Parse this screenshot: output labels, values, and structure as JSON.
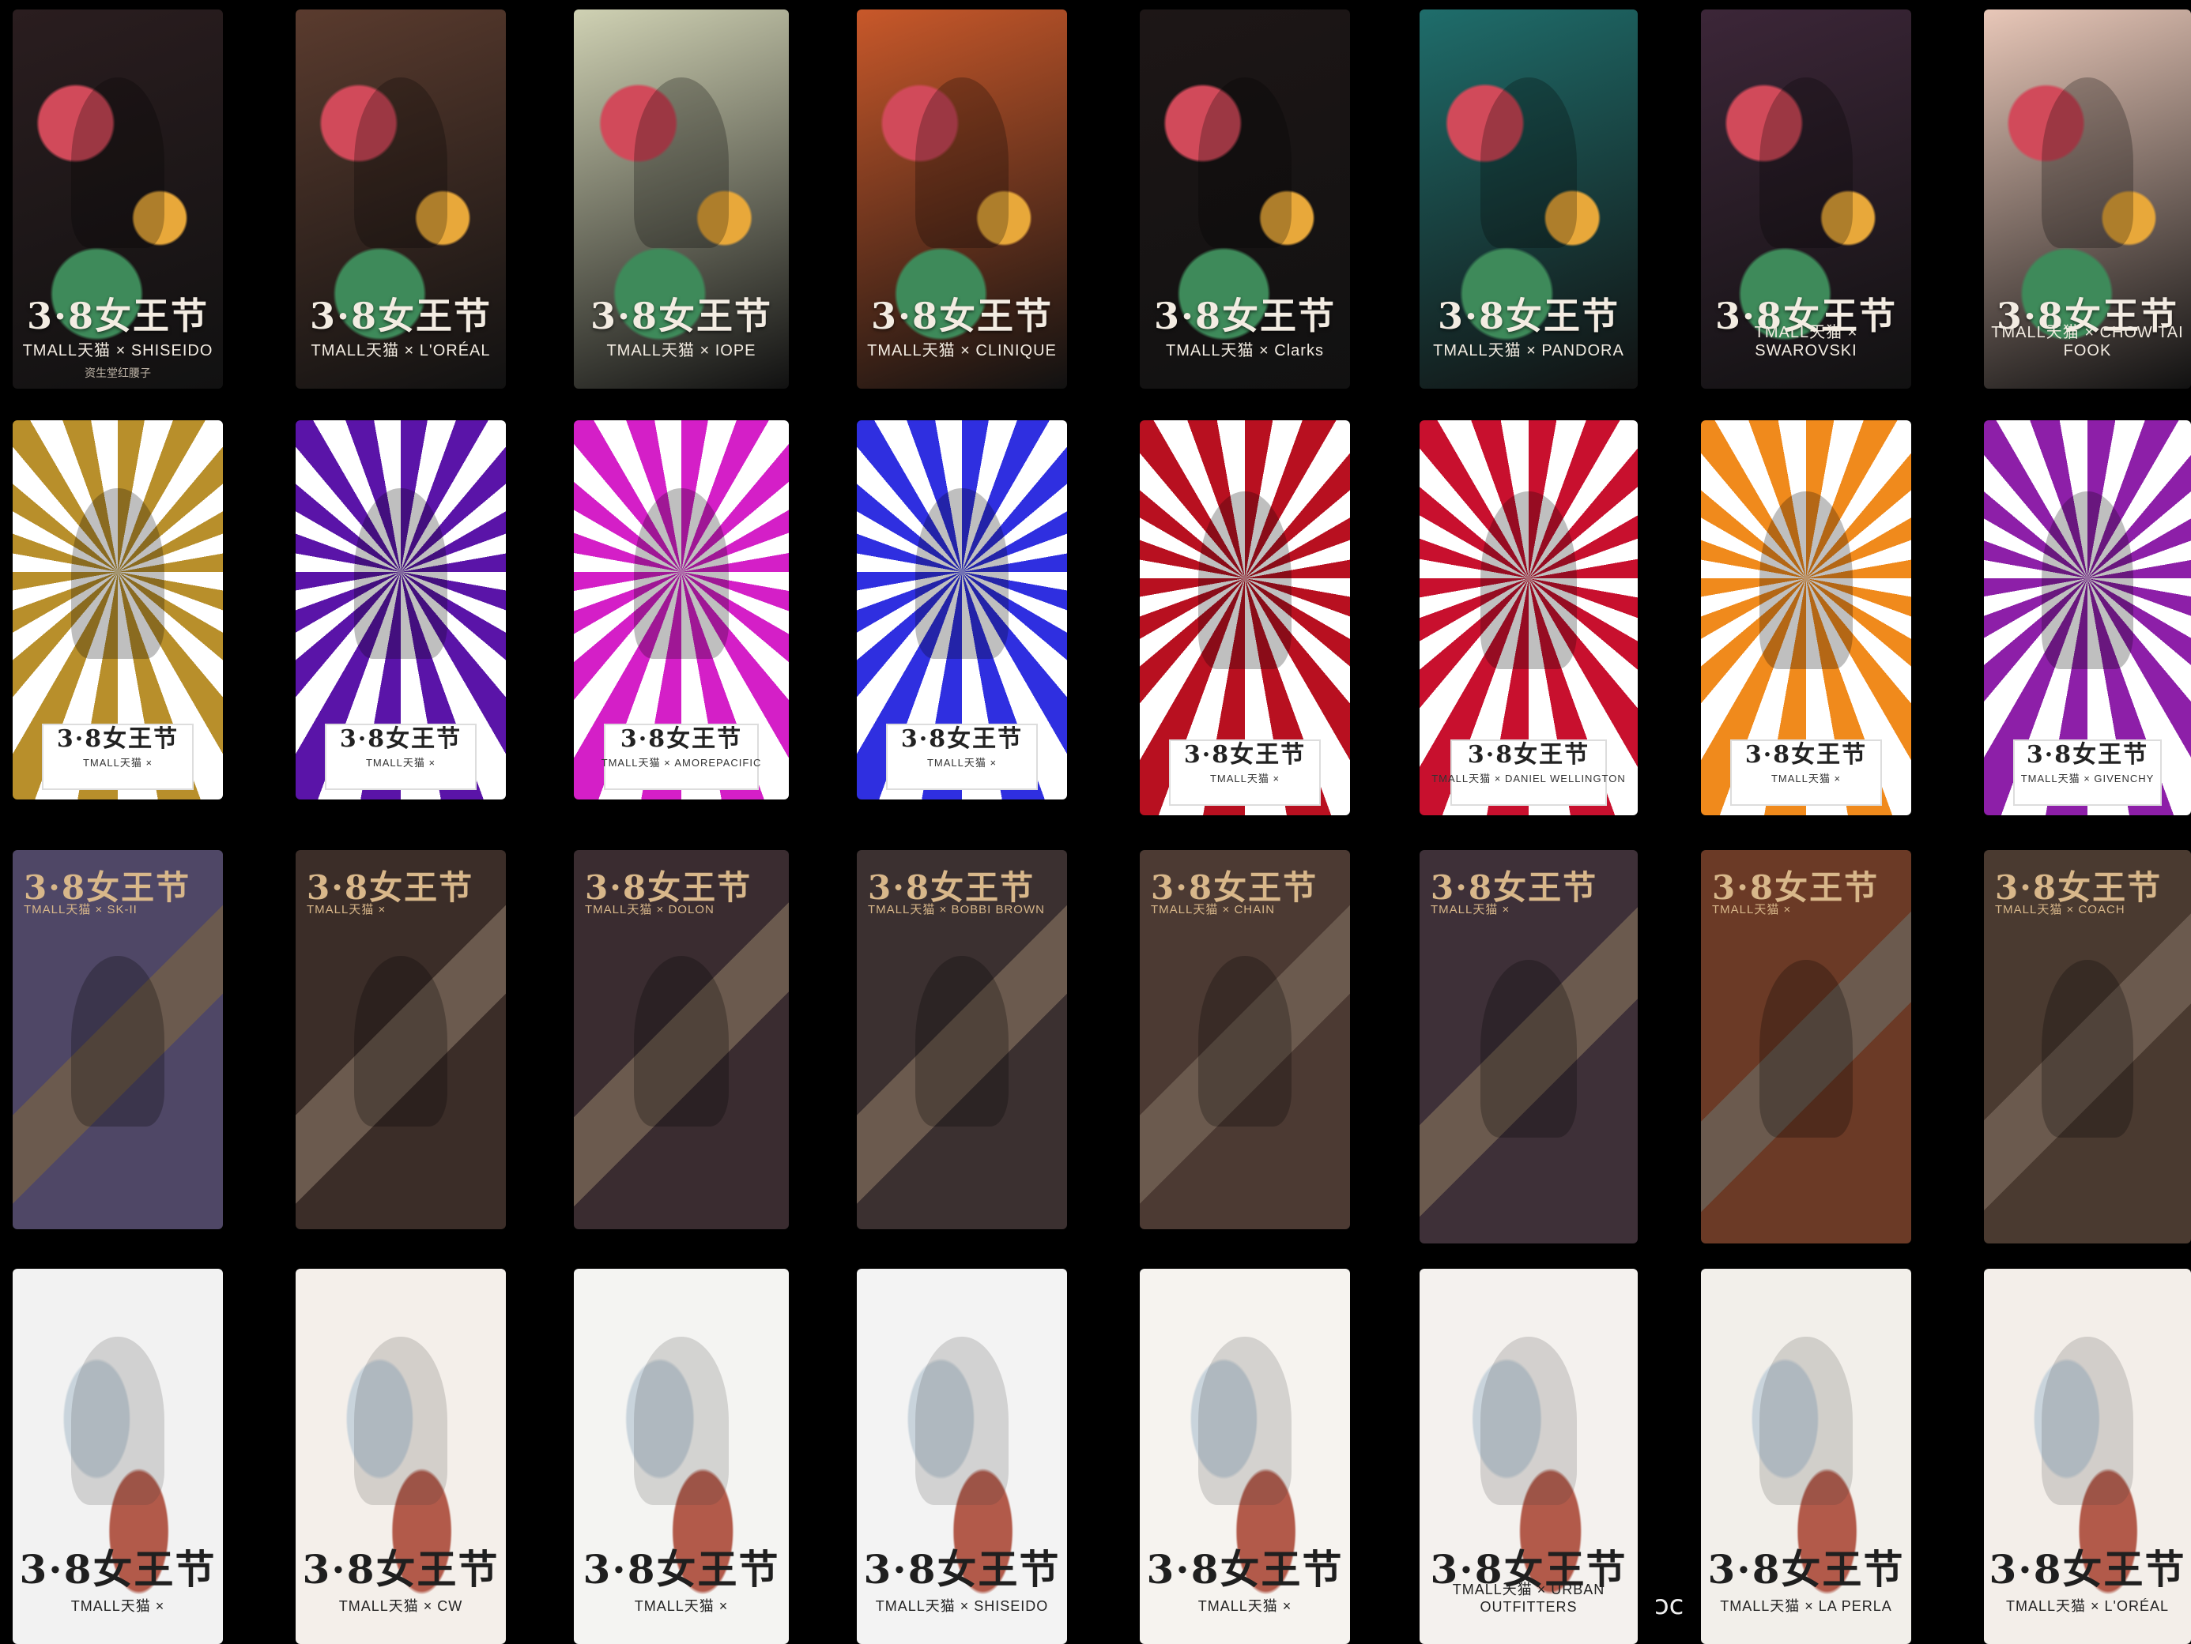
{
  "posters": [
    {
      "row": 1,
      "title": "3·8女王节",
      "sub": "TMALL天猫 × SHISEIDO",
      "note": "资生堂红腰子"
    },
    {
      "row": 1,
      "title": "3·8女王节",
      "sub": "TMALL天猫 × L'ORÉAL",
      "note": ""
    },
    {
      "row": 1,
      "title": "3·8女王节",
      "sub": "TMALL天猫 × IOPE",
      "note": ""
    },
    {
      "row": 1,
      "title": "3·8女王节",
      "sub": "TMALL天猫 × CLINIQUE",
      "note": ""
    },
    {
      "row": 1,
      "title": "3·8女王节",
      "sub": "TMALL天猫 × Clarks",
      "note": ""
    },
    {
      "row": 1,
      "title": "3·8女王节",
      "sub": "TMALL天猫 × PANDORA",
      "note": ""
    },
    {
      "row": 1,
      "title": "3·8女王节",
      "sub": "TMALL天猫 × SWAROVSKI",
      "note": ""
    },
    {
      "row": 1,
      "title": "3·8女王节",
      "sub": "TMALL天猫 × CHOW TAI FOOK",
      "note": ""
    },
    {
      "row": 2,
      "title": "3·8女王节",
      "sub": "TMALL天猫 ×",
      "note": ""
    },
    {
      "row": 2,
      "title": "3·8女王节",
      "sub": "TMALL天猫 ×",
      "note": ""
    },
    {
      "row": 2,
      "title": "3·8女王节",
      "sub": "TMALL天猫 × AMOREPACIFIC",
      "note": ""
    },
    {
      "row": 2,
      "title": "3·8女王节",
      "sub": "TMALL天猫 ×",
      "note": ""
    },
    {
      "row": 2,
      "title": "3·8女王节",
      "sub": "TMALL天猫 ×",
      "note": ""
    },
    {
      "row": 2,
      "title": "3·8女王节",
      "sub": "TMALL天猫 × DANIEL WELLINGTON",
      "note": ""
    },
    {
      "row": 2,
      "title": "3·8女王节",
      "sub": "TMALL天猫 ×",
      "note": ""
    },
    {
      "row": 2,
      "title": "3·8女王节",
      "sub": "TMALL天猫 × GIVENCHY",
      "note": ""
    },
    {
      "row": 3,
      "title": "3·8女王节",
      "sub": "TMALL天猫 × SK-II",
      "note": ""
    },
    {
      "row": 3,
      "title": "3·8女王节",
      "sub": "TMALL天猫 ×",
      "note": ""
    },
    {
      "row": 3,
      "title": "3·8女王节",
      "sub": "TMALL天猫 × DOLON",
      "note": ""
    },
    {
      "row": 3,
      "title": "3·8女王节",
      "sub": "TMALL天猫 × BOBBI BROWN",
      "note": ""
    },
    {
      "row": 3,
      "title": "3·8女王节",
      "sub": "TMALL天猫 × CHAIN",
      "note": ""
    },
    {
      "row": 3,
      "title": "3·8女王节",
      "sub": "TMALL天猫 ×",
      "note": ""
    },
    {
      "row": 3,
      "title": "3·8女王节",
      "sub": "TMALL天猫 ×",
      "note": ""
    },
    {
      "row": 3,
      "title": "3·8女王节",
      "sub": "TMALL天猫 × COACH",
      "note": ""
    },
    {
      "row": 4,
      "title": "3·8女王节",
      "sub": "TMALL天猫 ×",
      "note": ""
    },
    {
      "row": 4,
      "title": "3·8女王节",
      "sub": "TMALL天猫 × CW",
      "note": ""
    },
    {
      "row": 4,
      "title": "3·8女王节",
      "sub": "TMALL天猫 ×",
      "note": ""
    },
    {
      "row": 4,
      "title": "3·8女王节",
      "sub": "TMALL天猫 × SHISEIDO",
      "note": ""
    },
    {
      "row": 4,
      "title": "3·8女王节",
      "sub": "TMALL天猫 ×",
      "note": ""
    },
    {
      "row": 4,
      "title": "3·8女王节",
      "sub": "TMALL天猫 × URBAN OUTFITTERS",
      "note": ""
    },
    {
      "row": 4,
      "title": "3·8女王节",
      "sub": "TMALL天猫 × LA PERLA",
      "note": ""
    },
    {
      "row": 4,
      "title": "3·8女王节",
      "sub": "TMALL天猫 × L'ORÉAL",
      "note": ""
    }
  ],
  "stray_text": "ɔc",
  "colors": {
    "background": "#000000",
    "row1": [
      "#2a1d1f",
      "#5a3b2e",
      "#cfd1b3",
      "#c8582a",
      "#1d1616",
      "#1f6d6b",
      "#3c2638",
      "#e8c7b8"
    ],
    "row2": [
      "#b88f2b",
      "#5a14a8",
      "#d41fc7",
      "#2f2fe0",
      "#b81020",
      "#c8102e",
      "#f08a1c",
      "#8d1fa8"
    ],
    "row3": [
      "#4f4766",
      "#3b2d28",
      "#3a2c30",
      "#3b3030",
      "#4c3a33",
      "#3e3038",
      "#6b3a26",
      "#4a3a30"
    ],
    "row4": [
      "#f2f2f2",
      "#f4efea",
      "#f4f4f2",
      "#f3f3f3",
      "#f6f3ef",
      "#f4f1ee",
      "#f2efea",
      "#f3eee9"
    ]
  }
}
